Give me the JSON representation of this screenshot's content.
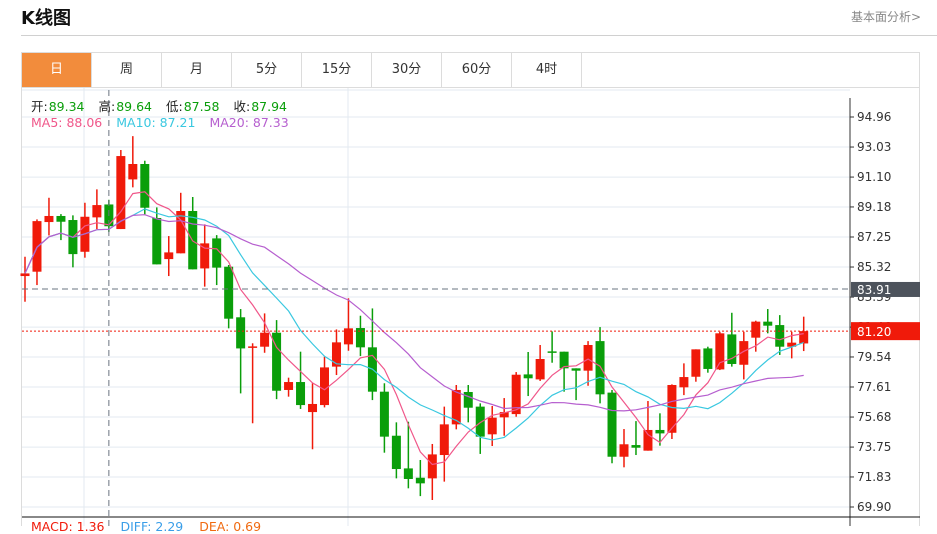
{
  "header": {
    "title": "K线图",
    "link": "基本面分析>"
  },
  "tabs": [
    {
      "label": "日",
      "active": true
    },
    {
      "label": "周"
    },
    {
      "label": "月"
    },
    {
      "label": "5分"
    },
    {
      "label": "15分"
    },
    {
      "label": "30分"
    },
    {
      "label": "60分"
    },
    {
      "label": "4时"
    }
  ],
  "info": {
    "open_label": "开:",
    "open": "89.34",
    "high_label": "高:",
    "high": "89.64",
    "low_label": "低:",
    "low": "87.58",
    "close_label": "收:",
    "close": "87.94"
  },
  "ma_legend": {
    "ma5": "MA5: 88.06",
    "ma10": "MA10: 87.21",
    "ma20": "MA20: 87.33"
  },
  "macd_legend": {
    "macd": "MACD: 1.36",
    "diff": "DIFF: 2.29",
    "dea": "DEA: 0.69"
  },
  "colors": {
    "up": "#f01a0a",
    "down": "#0a9e0a",
    "ma5": "#f0578a",
    "ma10": "#3ac8e0",
    "ma20": "#b65fcf",
    "accent": "#f28c3c",
    "crosshair_tag": "#4d535c"
  },
  "chart_data": {
    "type": "candlestick",
    "ylim": [
      69.9,
      94.96
    ],
    "y_ticks": [
      "94.96",
      "93.03",
      "91.10",
      "89.18",
      "87.25",
      "85.32",
      "83.39",
      "81.46",
      "79.54",
      "77.61",
      "75.68",
      "73.75",
      "71.83",
      "69.90"
    ],
    "crosshair_price": "83.91",
    "crosshair_index": 7,
    "last_price": "81.20",
    "ohlc": [
      [
        84.74,
        85.98,
        83.09,
        84.91
      ],
      [
        85.02,
        88.38,
        84.16,
        88.27
      ],
      [
        88.21,
        89.77,
        87.35,
        88.6
      ],
      [
        88.6,
        88.72,
        87.05,
        88.23
      ],
      [
        88.34,
        88.64,
        85.3,
        86.15
      ],
      [
        86.3,
        89.45,
        85.92,
        88.55
      ],
      [
        88.51,
        90.31,
        87.76,
        89.3
      ],
      [
        89.34,
        89.64,
        87.58,
        87.94
      ],
      [
        87.76,
        92.84,
        87.76,
        92.45
      ],
      [
        90.95,
        93.73,
        90.44,
        91.94
      ],
      [
        91.94,
        92.15,
        88.7,
        89.13
      ],
      [
        88.47,
        89.15,
        85.49,
        85.49
      ],
      [
        85.83,
        87.31,
        84.74,
        86.26
      ],
      [
        86.2,
        90.09,
        86.2,
        88.92
      ],
      [
        88.92,
        89.82,
        85.17,
        85.17
      ],
      [
        85.23,
        88.06,
        84.06,
        86.84
      ],
      [
        87.16,
        87.37,
        84.16,
        85.28
      ],
      [
        85.34,
        85.45,
        81.38,
        82.0
      ],
      [
        82.09,
        82.62,
        77.2,
        80.09
      ],
      [
        80.2,
        80.42,
        75.28,
        80.22
      ],
      [
        80.2,
        82.34,
        79.81,
        81.1
      ],
      [
        81.1,
        81.91,
        76.83,
        77.37
      ],
      [
        77.42,
        78.21,
        76.99,
        77.93
      ],
      [
        77.93,
        79.88,
        76.2,
        76.45
      ],
      [
        76.0,
        77.85,
        73.61,
        76.52
      ],
      [
        76.45,
        79.56,
        76.3,
        78.87
      ],
      [
        78.92,
        81.31,
        78.38,
        80.48
      ],
      [
        80.35,
        83.31,
        79.94,
        81.38
      ],
      [
        81.4,
        82.19,
        79.6,
        80.16
      ],
      [
        80.16,
        82.66,
        76.77,
        77.31
      ],
      [
        77.31,
        77.85,
        73.39,
        74.42
      ],
      [
        74.48,
        75.34,
        71.74,
        72.34
      ],
      [
        72.38,
        75.38,
        71.1,
        71.7
      ],
      [
        71.78,
        72.92,
        70.6,
        71.42
      ],
      [
        71.74,
        73.95,
        70.35,
        73.28
      ],
      [
        73.24,
        76.35,
        71.53,
        75.21
      ],
      [
        75.21,
        77.74,
        74.89,
        77.42
      ],
      [
        77.29,
        77.74,
        75.34,
        76.28
      ],
      [
        76.35,
        76.56,
        73.31,
        74.42
      ],
      [
        74.57,
        76.39,
        73.82,
        75.64
      ],
      [
        75.66,
        76.9,
        74.48,
        76.0
      ],
      [
        75.87,
        78.57,
        75.7,
        78.4
      ],
      [
        78.42,
        79.86,
        77.03,
        78.17
      ],
      [
        78.1,
        80.31,
        78.0,
        79.41
      ],
      [
        79.9,
        81.18,
        79.17,
        79.82
      ],
      [
        79.88,
        79.88,
        77.31,
        78.81
      ],
      [
        78.81,
        78.81,
        76.77,
        78.66
      ],
      [
        78.66,
        80.56,
        77.69,
        80.31
      ],
      [
        80.56,
        81.46,
        76.56,
        77.14
      ],
      [
        77.25,
        77.42,
        72.71,
        73.13
      ],
      [
        73.13,
        74.91,
        72.45,
        73.93
      ],
      [
        73.88,
        75.42,
        73.24,
        73.71
      ],
      [
        73.52,
        76.71,
        73.52,
        74.85
      ],
      [
        74.85,
        75.92,
        73.84,
        74.63
      ],
      [
        74.67,
        77.78,
        74.27,
        77.74
      ],
      [
        77.59,
        79.13,
        77.09,
        78.25
      ],
      [
        78.27,
        80.03,
        77.95,
        80.03
      ],
      [
        80.09,
        80.2,
        78.53,
        78.77
      ],
      [
        78.74,
        81.16,
        78.7,
        81.06
      ],
      [
        80.99,
        82.38,
        78.92,
        79.09
      ],
      [
        79.04,
        81.16,
        78.1,
        80.56
      ],
      [
        80.78,
        81.87,
        79.88,
        81.81
      ],
      [
        81.81,
        82.62,
        81.06,
        81.55
      ],
      [
        81.59,
        82.23,
        79.67,
        80.2
      ],
      [
        80.2,
        81.16,
        79.45,
        80.46
      ],
      [
        80.41,
        82.13,
        79.92,
        81.2
      ]
    ]
  }
}
